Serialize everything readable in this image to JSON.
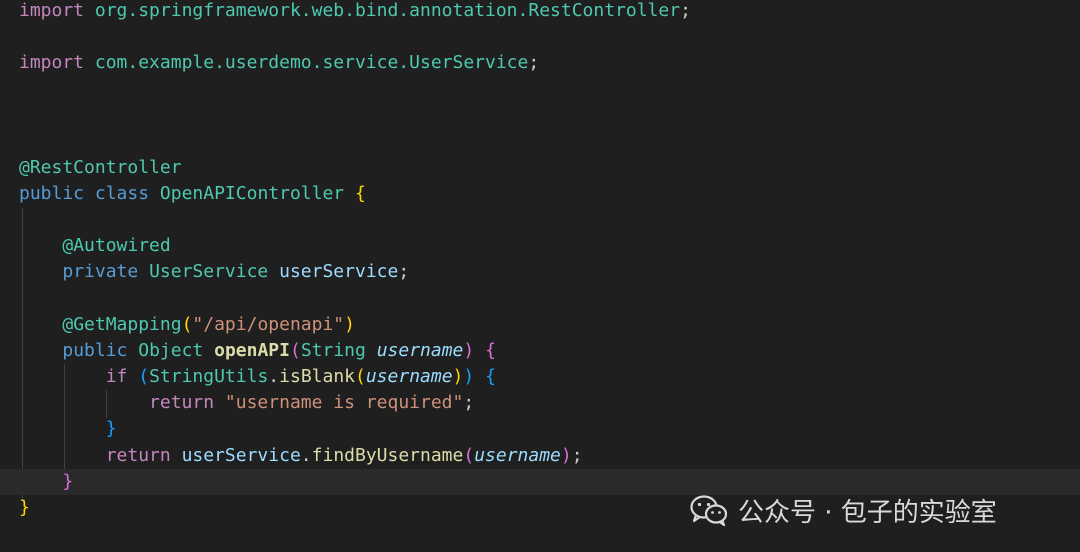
{
  "code": {
    "import_rest_kw": "import",
    "import_rest_path": "org.springframework.web.bind.annotation.RestController",
    "import_rest_semi": ";",
    "import_user_kw": "import",
    "import_user_path": "com.example.userdemo.service.UserService",
    "import_user_semi": ";",
    "anno_rest": "@RestController",
    "class_public": "public",
    "class_kw": "class",
    "class_name": "OpenAPIController",
    "class_open": "{",
    "anno_autowired": "@Autowired",
    "field_private": "private",
    "field_type": "UserService",
    "field_name": "userService",
    "field_semi": ";",
    "anno_getmapping": "@GetMapping",
    "anno_open_paren": "(",
    "anno_path": "\"/api/openapi\"",
    "anno_close_paren": ")",
    "method_public": "public",
    "method_return_type": "Object",
    "method_name": "openAPI",
    "method_open_paren": "(",
    "param_type": "String",
    "param_name": "username",
    "method_close_paren": ")",
    "method_open_brace": "{",
    "if_kw": "if",
    "if_open_paren": "(",
    "if_class": "StringUtils",
    "if_dot": ".",
    "if_method": "isBlank",
    "if_inner_open": "(",
    "if_arg": "username",
    "if_inner_close": ")",
    "if_close_paren": ")",
    "if_open_brace": "{",
    "return1_kw": "return",
    "return1_str": "\"username is required\"",
    "return1_semi": ";",
    "if_close_brace": "}",
    "return2_kw": "return",
    "return2_obj": "userService",
    "return2_dot": ".",
    "return2_method": "findByUsername",
    "return2_open": "(",
    "return2_arg": "username",
    "return2_close": ")",
    "return2_semi": ";",
    "method_close_brace": "}",
    "class_close_brace": "}"
  },
  "watermark": {
    "text": "公众号 · 包子的实验室",
    "logo_icon": "wechat-icon"
  },
  "colors": {
    "background": "#1f1f1f",
    "keyword": "#569cd6",
    "type": "#4ec9b0",
    "function": "#dcdcaa",
    "string": "#ce9178",
    "variable": "#9cdcfe"
  }
}
